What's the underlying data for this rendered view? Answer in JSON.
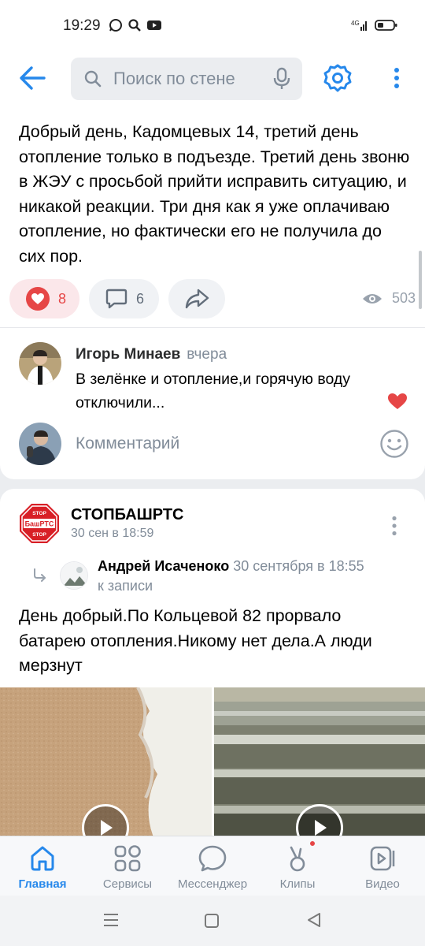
{
  "status_bar": {
    "time": "19:29"
  },
  "header": {
    "search_placeholder": "Поиск по стене"
  },
  "post1": {
    "text": "Добрый день, Кадомцевых 14, третий день отопление только в подъезде. Третий день звоню в ЖЭУ с просьбой прийти исправить ситуацию, и никакой реакции. Три дня как я уже оплачиваю отопление, но фактически его не получила до сих пор.",
    "likes": "8",
    "comments": "6",
    "views": "503"
  },
  "comment": {
    "author": "Игорь Минаев",
    "time": "вчера",
    "text": "В зелёнке и отопление,и горячую воду отключили..."
  },
  "comment_input": {
    "placeholder": "Комментарий"
  },
  "post2": {
    "group_name": "СТОПБАШРТС",
    "date": "30 сен в 18:59",
    "logo_text_top": "STOP",
    "logo_text_mid": "БашРТС",
    "logo_text_bottom": "STOP",
    "repost_author": "Андрей Исаченоко",
    "repost_meta": "30 сентября в 18:55 к записи",
    "text": "День добрый.По Кольцевой 82 прорвало батарею отопления.Никому нет дела.А люди мерзнут"
  },
  "tabbar": {
    "tabs": [
      {
        "label": "Главная",
        "icon": "home-icon"
      },
      {
        "label": "Сервисы",
        "icon": "services-icon"
      },
      {
        "label": "Мессенджер",
        "icon": "messenger-icon"
      },
      {
        "label": "Клипы",
        "icon": "clips-icon"
      },
      {
        "label": "Видео",
        "icon": "video-icon"
      }
    ]
  },
  "colors": {
    "accent": "#2688eb",
    "like": "#e64646",
    "muted": "#818c99"
  }
}
